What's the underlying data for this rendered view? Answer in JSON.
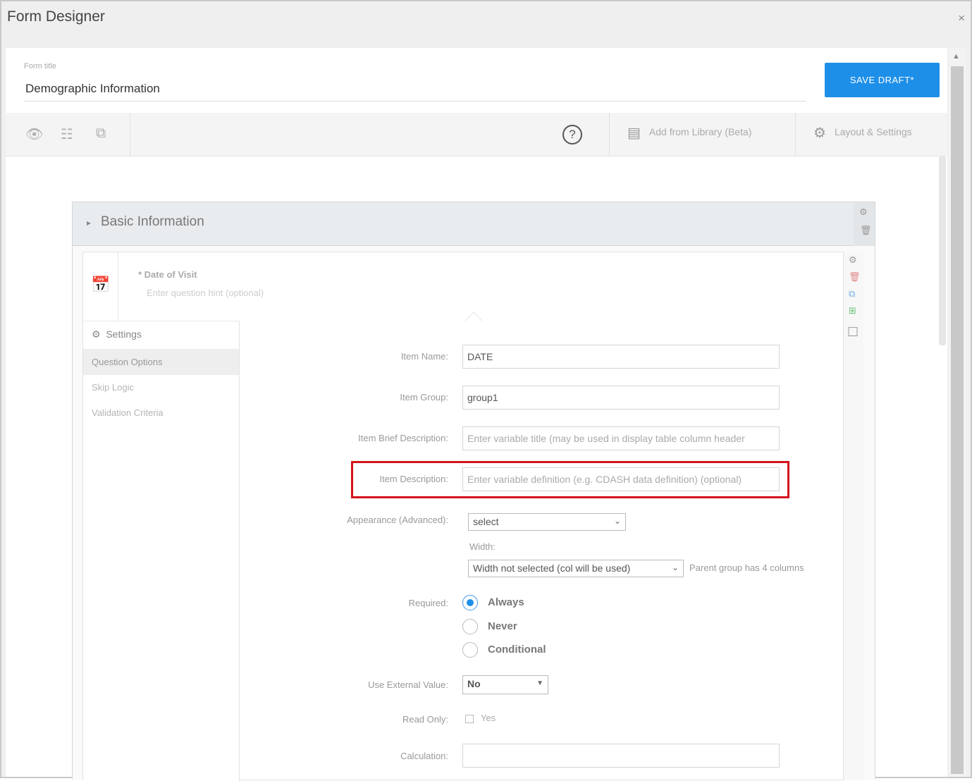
{
  "window": {
    "title": "Form Designer",
    "close_glyph": "×"
  },
  "header": {
    "form_title_label": "Form title",
    "form_title_value": "Demographic Information",
    "save_label": "SAVE DRAFT*"
  },
  "toolbar": {
    "help_glyph": "?",
    "add_from_library": "Add from Library (Beta)",
    "layout_settings": "Layout & Settings"
  },
  "section": {
    "caret": "▸",
    "title": "Basic Information"
  },
  "question": {
    "title": "* Date of Visit",
    "hint": "Enter question hint (optional)"
  },
  "settings_nav": {
    "heading": "Settings",
    "items": [
      "Question Options",
      "Skip Logic",
      "Validation Criteria"
    ],
    "active_index": 0
  },
  "fields": {
    "item_name": {
      "label": "Item Name:",
      "value": "DATE"
    },
    "item_group": {
      "label": "Item Group:",
      "value": "group1"
    },
    "item_brief_description": {
      "label": "Item Brief Description:",
      "placeholder": "Enter variable title (may be used in display table column header"
    },
    "item_description": {
      "label": "Item Description:",
      "placeholder": "Enter variable definition (e.g. CDASH data definition) (optional)"
    },
    "appearance": {
      "label": "Appearance (Advanced):",
      "value": "select"
    },
    "width": {
      "label": "Width:",
      "value": "Width not selected (col will be used)",
      "note": "Parent group has 4 columns"
    },
    "required": {
      "label": "Required:",
      "options": [
        "Always",
        "Never",
        "Conditional"
      ],
      "selected_index": 0
    },
    "use_external_value": {
      "label": "Use External Value:",
      "value": "No"
    },
    "read_only": {
      "label": "Read Only:",
      "option": "Yes"
    },
    "calculation": {
      "label": "Calculation:",
      "value": ""
    }
  },
  "colors": {
    "accent": "#1e8fe8",
    "highlight": "#d4141c"
  }
}
